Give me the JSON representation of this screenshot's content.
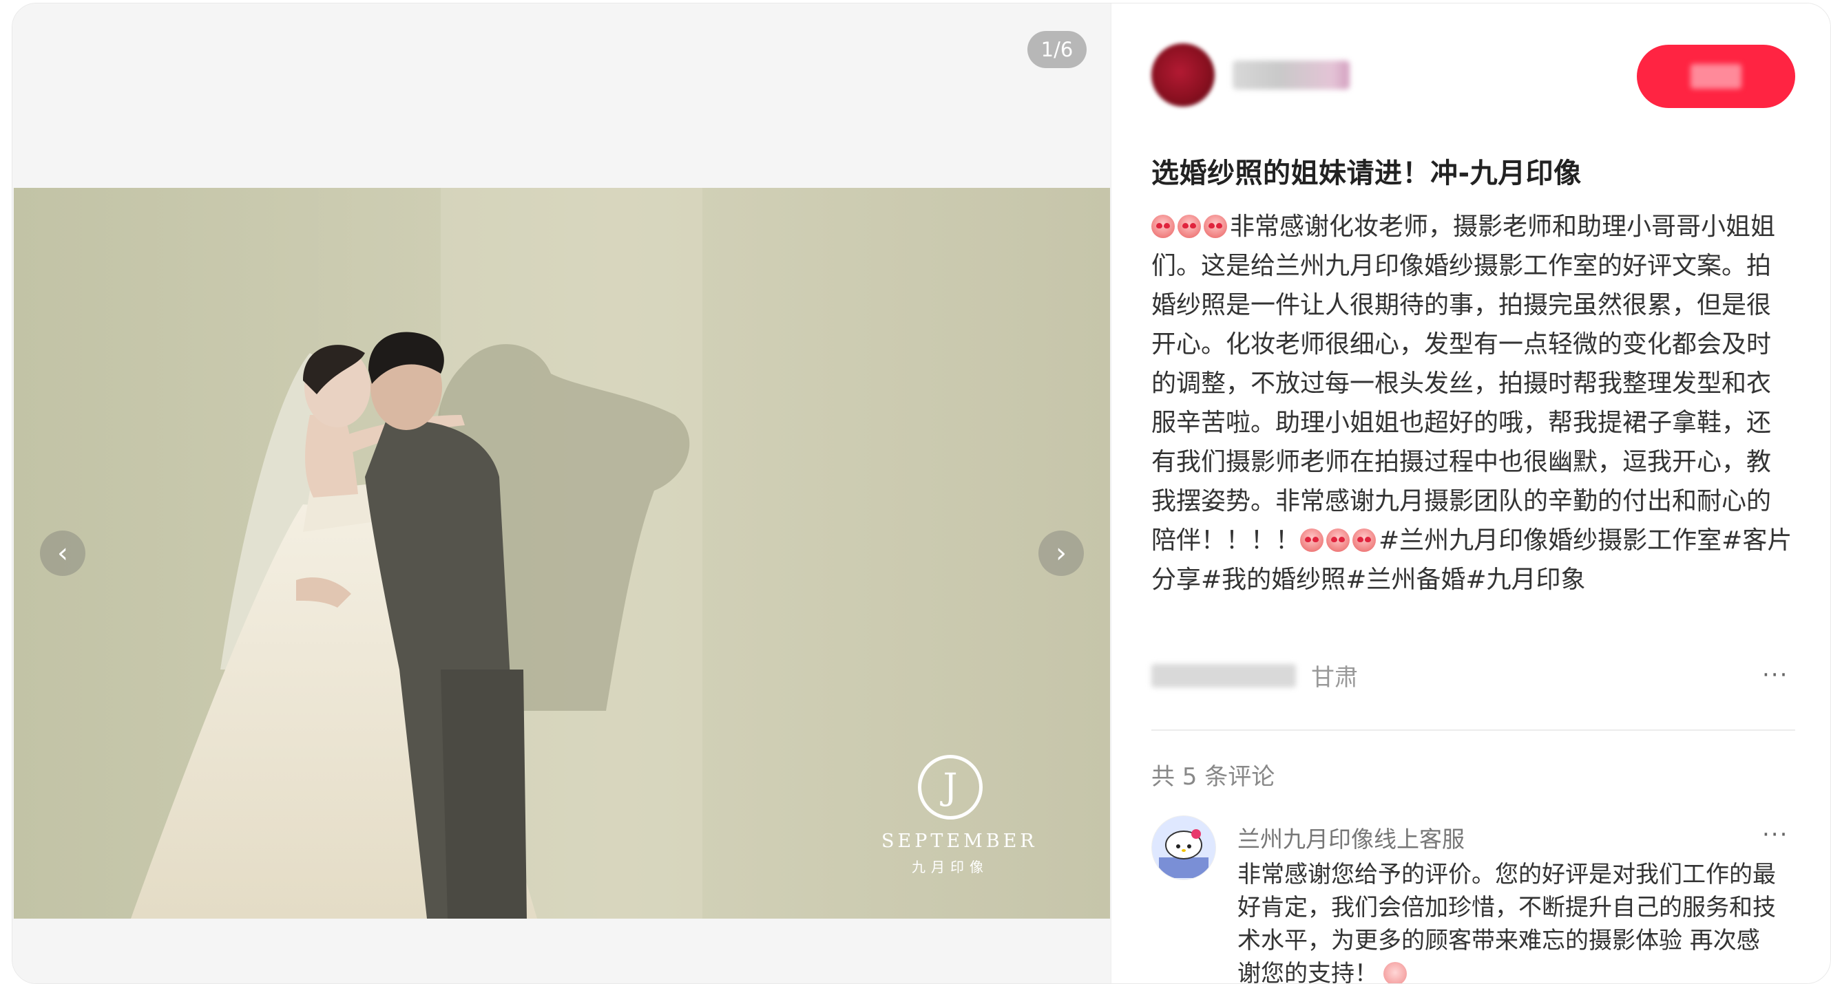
{
  "media": {
    "counter": "1/6",
    "brand_en": "SEPTEMBER",
    "brand_cn": "九月印像",
    "brand_mark": "J"
  },
  "author": {
    "follow_label": ""
  },
  "post": {
    "title": "选婚纱照的姐妹请进！冲-九月印像",
    "description": "非常感谢化妆老师，摄影老师和助理小哥哥小姐姐们。这是给兰州九月印像婚纱摄影工作室的好评文案。拍婚纱照是一件让人很期待的事，拍摄完虽然很累，但是很开心。化妆老师很细心，发型有一点轻微的变化都会及时的调整，不放过每一根头发丝，拍摄时帮我整理发型和衣服辛苦啦。助理小姐姐也超好的哦，帮我提裙子拿鞋，还有我们摄影师老师在拍摄过程中也很幽默，逗我开心，教我摆姿势。非常感谢九月摄影团队的辛勤的付出和耐心的陪伴！！！！",
    "tags": "#兰州九月印像婚纱摄影工作室#客片分享#我的婚纱照#兰州备婚#九月印象",
    "location": "甘肃",
    "more": "···"
  },
  "comments": {
    "count_label": "共 5 条评论",
    "items": [
      {
        "author": "兰州九月印像线上客服",
        "text": "非常感谢您给予的评价。您的好评是对我们工作的最好肯定，我们会倍加珍惜，不断提升自己的服务和技术水平，为更多的顾客带来难忘的摄影体验 再次感谢您的支持！",
        "more": "···"
      }
    ]
  },
  "icons": {
    "prev": "chevron-left-icon",
    "next": "chevron-right-icon",
    "emoji": "heart-eyes-emoji-icon"
  },
  "colors": {
    "follow": "#ff2442",
    "photo_bg": "#c9c7ad"
  }
}
